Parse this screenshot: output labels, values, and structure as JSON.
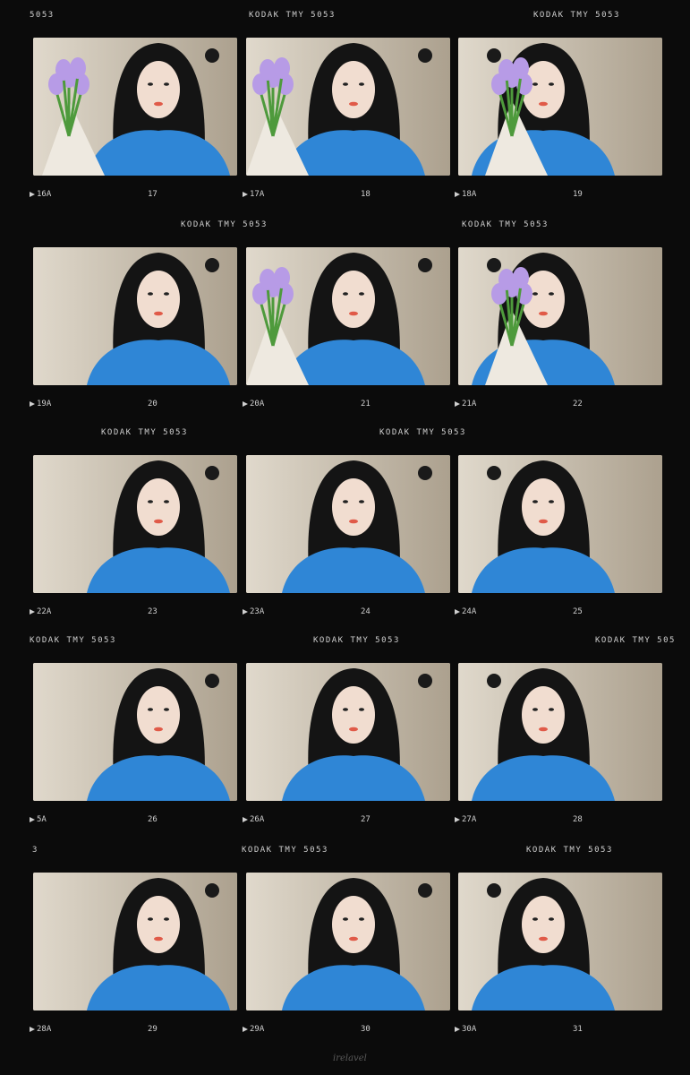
{
  "strips": [
    {
      "kodak": [
        "5053",
        "KODAK TMY 5053",
        "KODAK TMY 5053"
      ],
      "numbers": [
        [
          "16A",
          "17"
        ],
        [
          "17A",
          "18"
        ],
        [
          "18A",
          "19"
        ]
      ],
      "flowers": [
        true,
        true,
        true
      ]
    },
    {
      "kodak": [
        "KODAK TMY 5053",
        "KODAK TMY 5053"
      ],
      "numbers": [
        [
          "19A",
          "20"
        ],
        [
          "20A",
          "21"
        ],
        [
          "21A",
          "22"
        ]
      ],
      "flowers": [
        false,
        true,
        true
      ]
    },
    {
      "kodak": [
        "KODAK TMY 5053",
        "KODAK TMY 5053"
      ],
      "numbers": [
        [
          "22A",
          "23"
        ],
        [
          "23A",
          "24"
        ],
        [
          "24A",
          "25"
        ]
      ],
      "flowers": [
        false,
        false,
        false
      ]
    },
    {
      "kodak": [
        "KODAK TMY 5053",
        "KODAK TMY 5053",
        "KODAK TMY 505"
      ],
      "numbers": [
        [
          "5A",
          "26"
        ],
        [
          "26A",
          "27"
        ],
        [
          "27A",
          "28"
        ]
      ],
      "flowers": [
        false,
        false,
        false
      ]
    },
    {
      "kodak": [
        "3",
        "KODAK TMY 5053",
        "KODAK TMY 5053"
      ],
      "numbers": [
        [
          "28A",
          "29"
        ],
        [
          "29A",
          "30"
        ],
        [
          "30A",
          "31"
        ]
      ],
      "flowers": [
        false,
        false,
        false
      ]
    }
  ],
  "signature": "irelavel",
  "colors": {
    "film": "#0b0b0b",
    "sweater": "#2f86d6",
    "tulip": "#b79be6",
    "wall": "#cfc4b0",
    "hair": "#141414"
  }
}
